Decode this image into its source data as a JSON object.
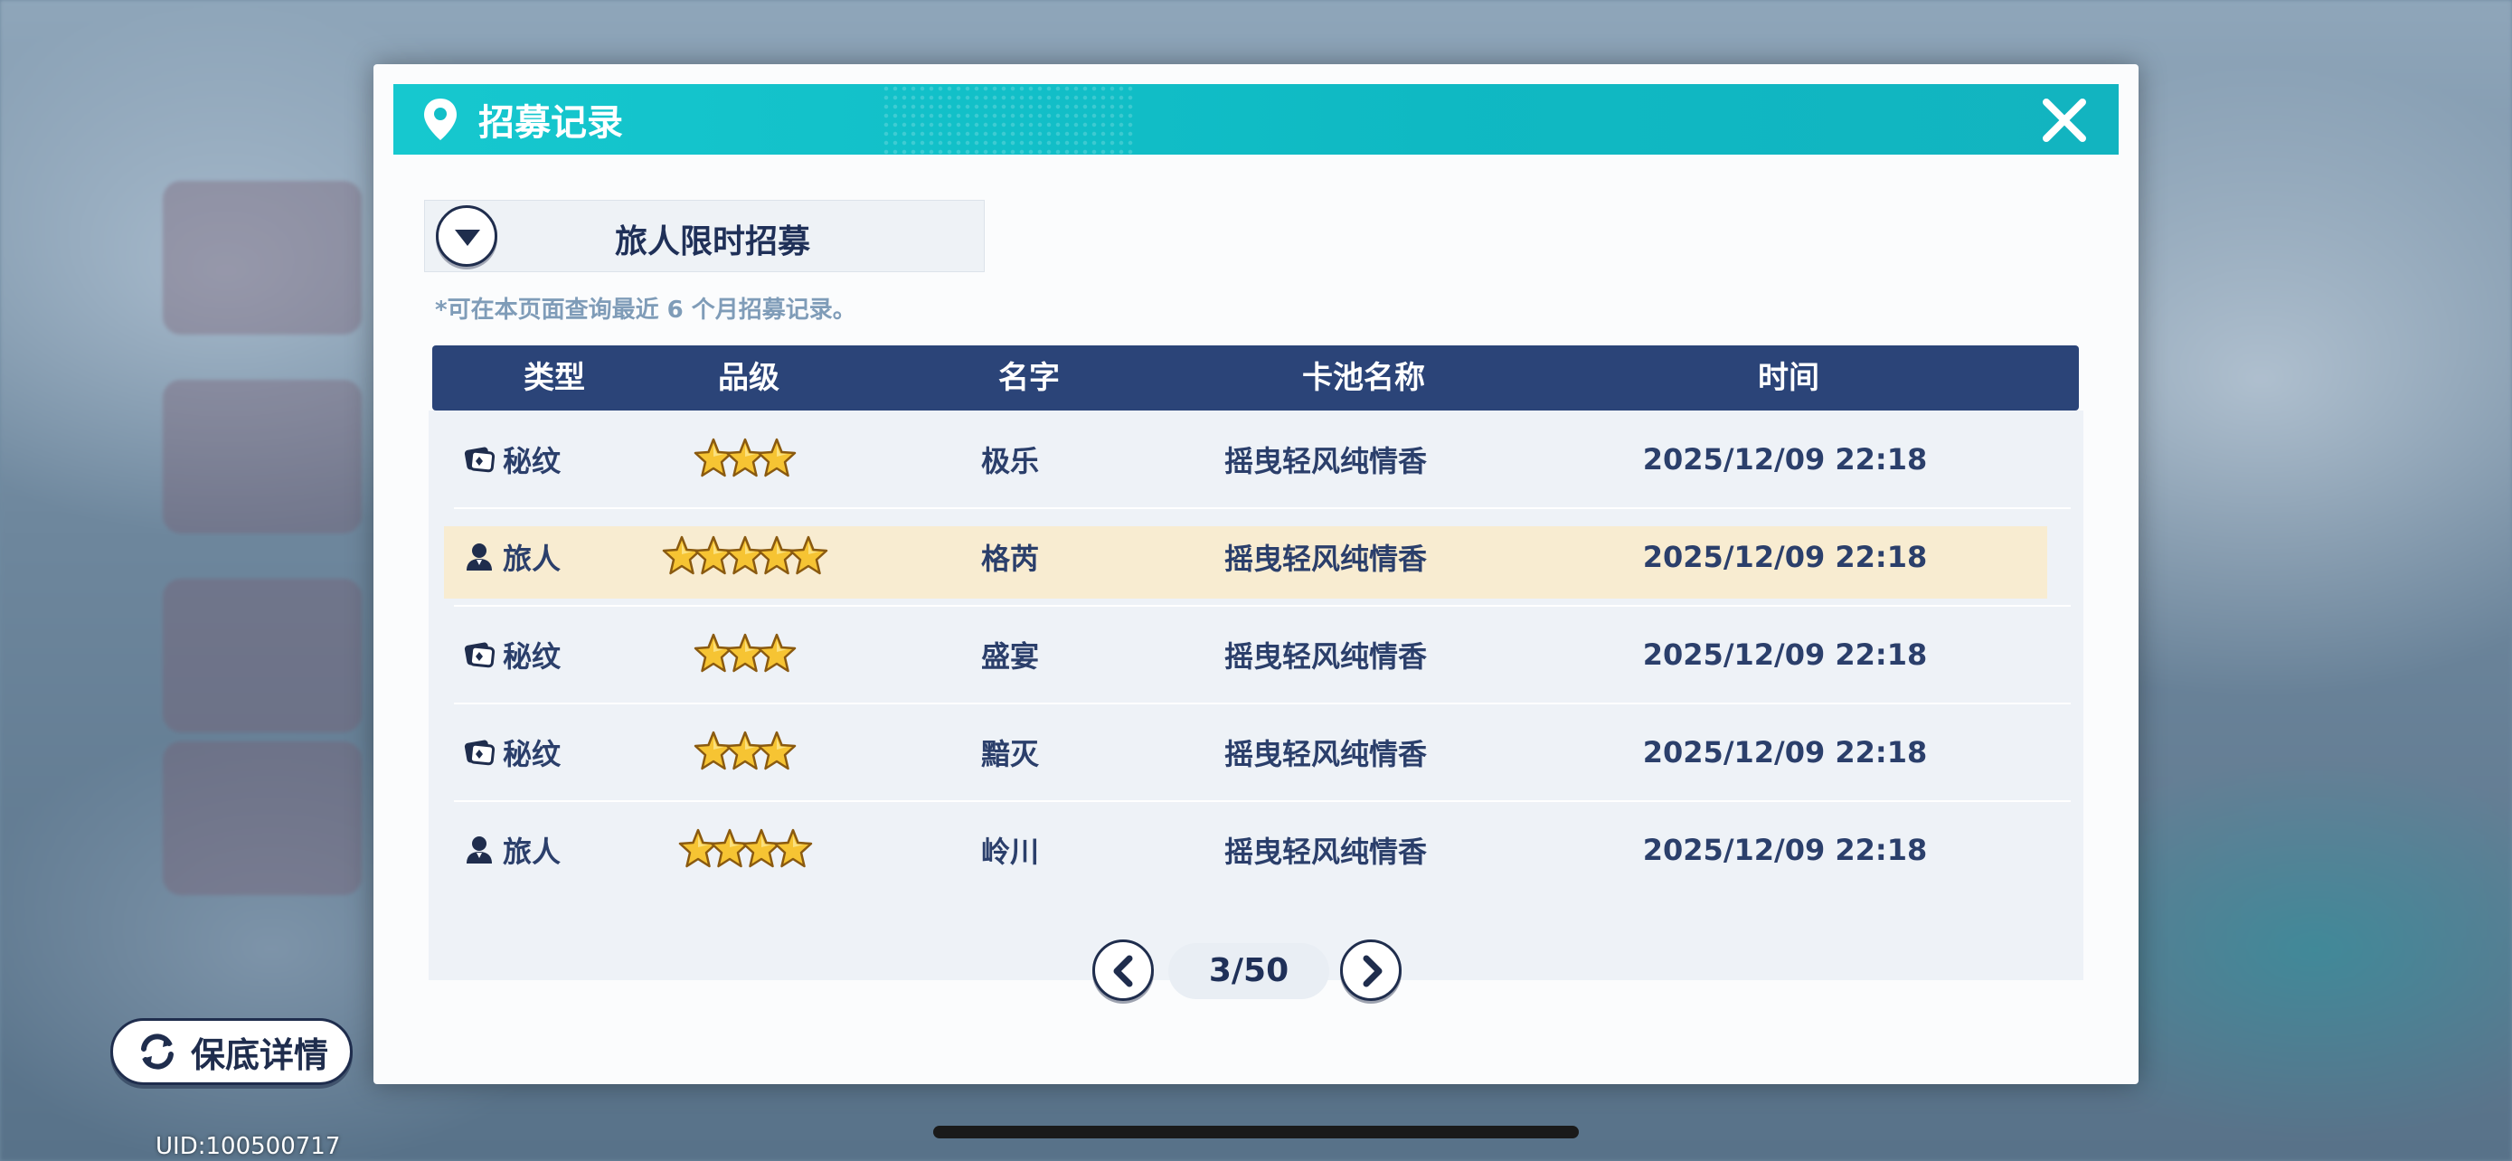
{
  "modal": {
    "title": "招募记录",
    "pool_selected": "旅人限时招募",
    "note": "*可在本页面查询最近 6 个月招募记录。"
  },
  "table": {
    "headers": [
      "类型",
      "品级",
      "名字",
      "卡池名称",
      "时间"
    ],
    "rows": [
      {
        "type": "秘纹",
        "type_icon": "rune-card-icon",
        "stars": 3,
        "name": "极乐",
        "pool": "摇曳轻风纯情香",
        "time": "2025/12/09 22:18",
        "highlight": false
      },
      {
        "type": "旅人",
        "type_icon": "traveler-person-icon",
        "stars": 5,
        "name": "格芮",
        "pool": "摇曳轻风纯情香",
        "time": "2025/12/09 22:18",
        "highlight": true
      },
      {
        "type": "秘纹",
        "type_icon": "rune-card-icon",
        "stars": 3,
        "name": "盛宴",
        "pool": "摇曳轻风纯情香",
        "time": "2025/12/09 22:18",
        "highlight": false
      },
      {
        "type": "秘纹",
        "type_icon": "rune-card-icon",
        "stars": 3,
        "name": "黯灭",
        "pool": "摇曳轻风纯情香",
        "time": "2025/12/09 22:18",
        "highlight": false
      },
      {
        "type": "旅人",
        "type_icon": "traveler-person-icon",
        "stars": 4,
        "name": "岭川",
        "pool": "摇曳轻风纯情香",
        "time": "2025/12/09 22:18",
        "highlight": false
      }
    ]
  },
  "pager": {
    "label": "3/50",
    "current": 3,
    "total": 50
  },
  "pity_button": {
    "label": "保底详情"
  },
  "uid": "UID:100500717",
  "colors": {
    "header_teal": "#12bfc8",
    "table_header_navy": "#2b4478",
    "highlight_row": "#f8ecd1",
    "text_navy": "#2b3f6b"
  }
}
